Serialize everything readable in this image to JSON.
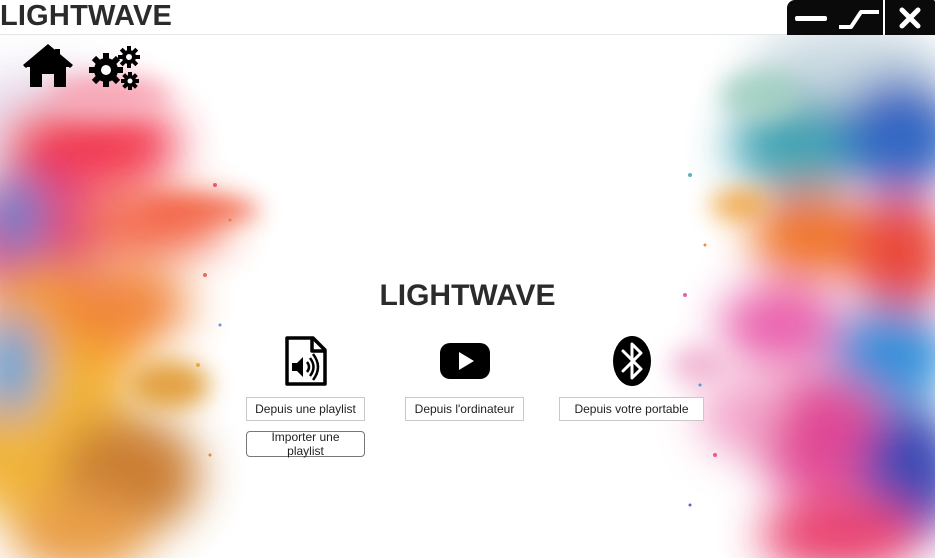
{
  "window": {
    "title": "LIGHTWAVE"
  },
  "nav": {
    "home_icon": "home-icon",
    "settings_icon": "gears-icon"
  },
  "main": {
    "title": "LIGHTWAVE",
    "sources": [
      {
        "icon": "audio-file-icon",
        "label": "Depuis une playlist",
        "secondary_label": "Importer une playlist"
      },
      {
        "icon": "youtube-icon",
        "label": "Depuis l'ordinateur"
      },
      {
        "icon": "bluetooth-icon",
        "label": "Depuis votre portable"
      }
    ]
  },
  "colors": {
    "title_text": "#2b2b2b",
    "window_controls": "#0a0a0a",
    "background": "#ffffff"
  }
}
